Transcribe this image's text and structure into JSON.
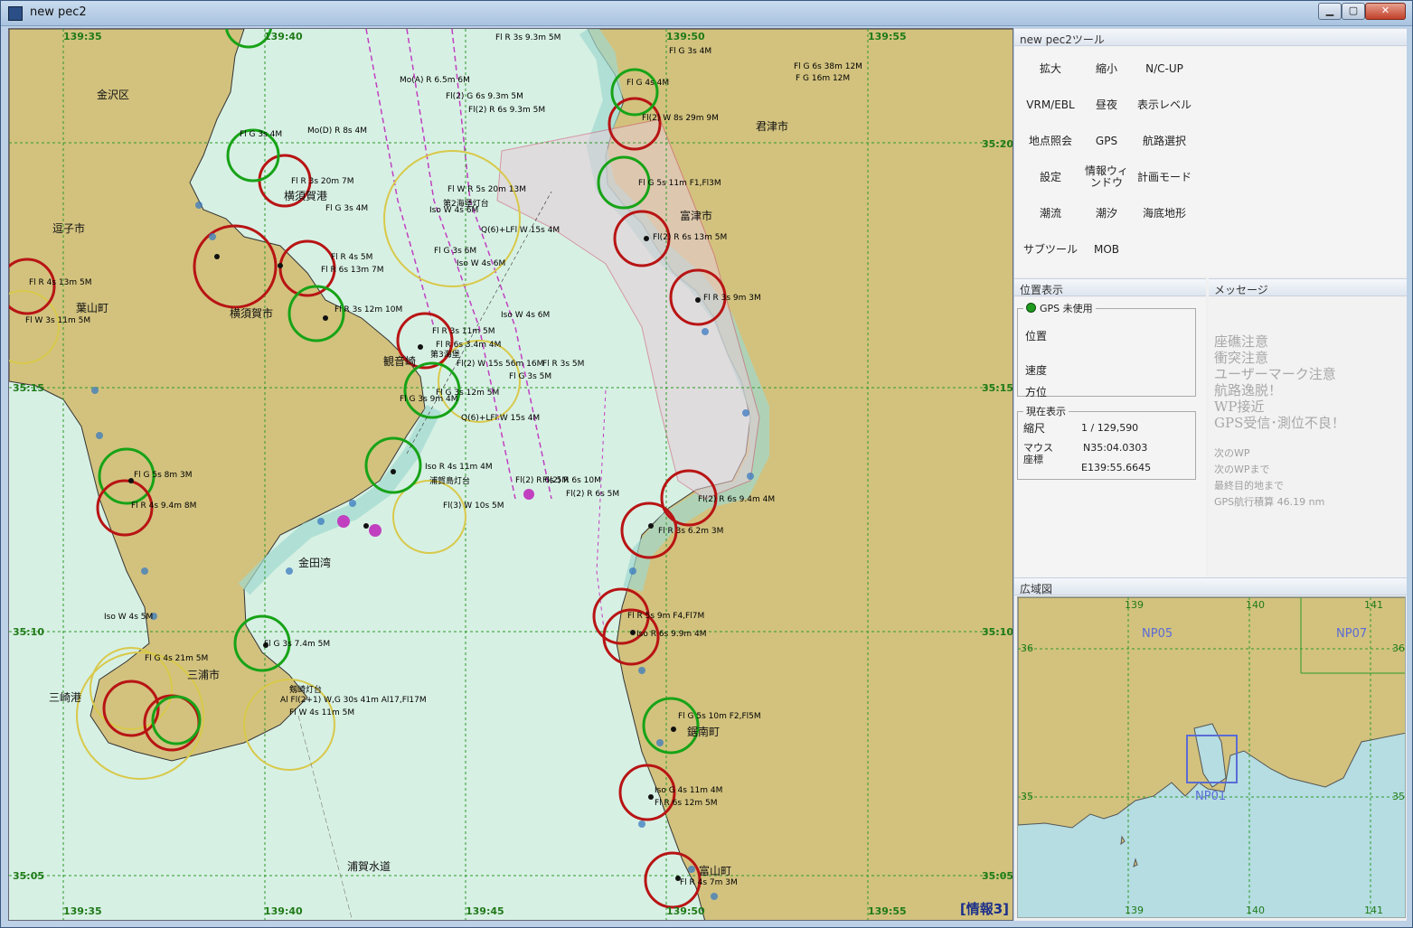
{
  "window": {
    "title": "new pec2",
    "minimize": "▁",
    "maximize": "▢",
    "close": "✕"
  },
  "chart": {
    "info_label": "[情報3]",
    "lon_labels": [
      "139:35",
      "139:40",
      "139:45",
      "139:50",
      "139:55"
    ],
    "lat_labels": [
      "35:20",
      "35:15",
      "35:10",
      "35:05"
    ],
    "places": [
      "金沢区",
      "逗子市",
      "葉山町",
      "横須賀市",
      "横須賀港",
      "観音崎",
      "金田湾",
      "三浦市",
      "三崎港",
      "浦賀水道",
      "君津市",
      "富津市",
      "鋸南町",
      "富山町"
    ],
    "lights": [
      "Fl R 3s 9.3m 5M",
      "Mo(A) R 6.5m 6M",
      "Fl(2) G 6s 9.3m 5M",
      "Fl(2) R 6s 9.3m 5M",
      "Fl G 3s 4M",
      "Fl R 3s 20m 7M",
      "Fl G 3s 4M",
      "Fl R 4s 5M",
      "Fl W R 5s 20m 13M",
      "Iso W 4s 6M",
      "Fl G 3s 6M",
      "Q(6)+LFl W 15s 4M",
      "Iso W 4s 6M",
      "Fl R 3s 11m 5M",
      "Fl R 6s 3.4m 4M",
      "Fl(2) W 15s 56m 16M",
      "Fl G 3s 5M",
      "Iso W 4s 6M",
      "Fl R 3s 5M",
      "Fl G 3s 12m 5M",
      "Fl G 3s 9m 4M",
      "Q(6)+LFl W 15s 4M",
      "Iso R 4s 11m 4M",
      "Fl(2) R 6s 5M",
      "Fl(2) R 6s 10M",
      "Fl(2) R 6s 5M",
      "Fl(3) W 10s 5M",
      "Fl(2) R 6s 13m 5M",
      "Fl R 3s 9m 3M",
      "Fl(2) R 6s 9.4m 4M",
      "Fl R 3s 6.2m 3M",
      "Fl R 5s 9m F4,Fl7M",
      "Iso R 6s 9.9m 4M",
      "Fl G 5s 10m F2,Fl5M",
      "Iso G 4s 11m 4M",
      "Fl R 6s 12m 5M",
      "Fl R 4s 7m 3M",
      "Fl G 3s 7.4m 5M",
      "Fl G 5s 11m F1,Fl3M",
      "Fl R 4s 13m 5M",
      "Fl W 3s 11m 5M",
      "Fl G 5s 8m 3M",
      "Fl R 4s 9.4m 8M",
      "Iso W 4s 5M",
      "Fl G 4s 21m 5M",
      "Al Fl(2+1) W,G 30s 41m Al17,Fl17M",
      "Fl W 4s 11m 5M",
      "Fl G 3s 4M",
      "Fl G 6s 38m 12M",
      "F G 16m 12M",
      "Fl(2) W 8s 29m 9M",
      "Fl G 4s 4M",
      "Fl R 3s 12m 10M",
      "Fl R 6s 13m 7M",
      "Mo(D) R 8s 4M",
      "第2海堡灯台",
      "第3海堡",
      "浦賀島灯台",
      "剱崎灯台"
    ]
  },
  "tools": {
    "header": "new pec2ツール",
    "buttons": [
      "拡大",
      "縮小",
      "N/C-UP",
      "VRM/EBL",
      "昼夜",
      "表示レベル",
      "地点照会",
      "GPS",
      "航路選択",
      "設定",
      "情報ウィンドウ",
      "計画モード",
      "潮流",
      "潮汐",
      "海底地形",
      "サブツール",
      "MOB"
    ]
  },
  "position": {
    "header": "位置表示",
    "gps_label": "GPS 未使用",
    "pos_label": "位置",
    "speed_label": "速度",
    "heading_label": "方位",
    "current_header": "現在表示",
    "scale_label": "縮尺",
    "scale_value": "1 / 129,590",
    "mouse_label1": "マウス",
    "mouse_label2": "座標",
    "mouse_lat": "N35:04.0303",
    "mouse_lon": "E139:55.6645"
  },
  "messages": {
    "header": "メッセージ",
    "alerts": [
      "座礁注意",
      "衝突注意",
      "ユーザーマーク注意",
      "航路逸脱！",
      "WP接近",
      "GPS受信･測位不良！"
    ],
    "info": [
      "次のWP",
      "次のWPまで",
      "最終目的地まで",
      "GPS航行積算 46.19 nm"
    ]
  },
  "overview": {
    "header": "広域図",
    "top_ticks": [
      "139",
      "140",
      "141"
    ],
    "bottom_ticks": [
      "139",
      "140",
      "141"
    ],
    "lat_36": "36",
    "lat_35": "35",
    "sheets": [
      "NP05",
      "NP07",
      "NP01"
    ]
  },
  "colors": {
    "land": "#d2c27e",
    "sea_shallow": "#b9e3dc",
    "sea": "#d7f0e4",
    "red_ring": "#b81414",
    "green_ring": "#17a317",
    "yellow_ring": "#d8c94a",
    "grid": "#2e9a2a"
  }
}
